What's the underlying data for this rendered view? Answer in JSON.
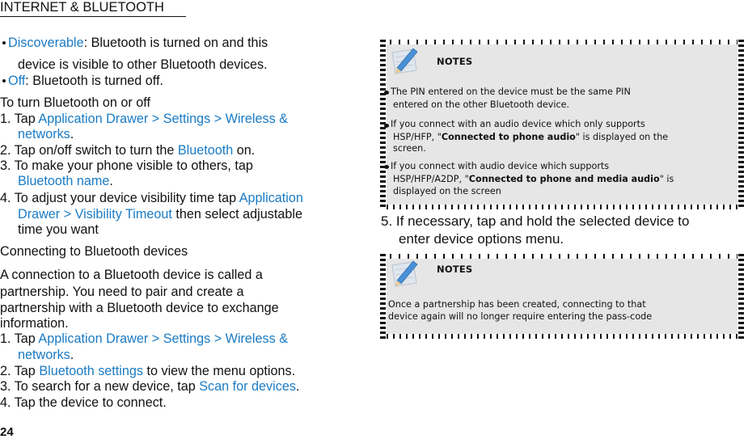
{
  "header": {
    "title": "INTERNET & BLUETOOTH"
  },
  "modes": [
    {
      "term": "Discoverable",
      "rest_line1": ": Bluetooth is turned on and this",
      "rest_line2": "device is visible to other Bluetooth devices."
    },
    {
      "term": "Off",
      "rest_line1": ": Bluetooth is turned off."
    }
  ],
  "turn_on_off": {
    "heading": "To turn Bluetooth on or off",
    "steps": [
      {
        "num": "1. Tap ",
        "link1": "Application Drawer > Settings > Wireless &",
        "link2": "networks",
        "tail": "."
      },
      {
        "num": "2. Tap on/off switch to turn the ",
        "link": "Bluetooth",
        "tail": " on."
      },
      {
        "num": "3. To make your phone visible to others, tap",
        "link": "Bluetooth name",
        "tail": "."
      },
      {
        "num": "4. To adjust your device visibility time tap ",
        "link1": "Application",
        "link2": "Drawer > Visibility Timeout",
        "tail2": " then select adjustable",
        "line3": "time you want"
      }
    ]
  },
  "connecting": {
    "heading": "Connecting to Bluetooth devices",
    "para_lines": [
      "A connection to a Bluetooth device is called a",
      "partnership. You need to pair and create a",
      "partnership with a Bluetooth device to exchange",
      "information."
    ],
    "steps": [
      {
        "num": "1. Tap ",
        "link1": "Application Drawer > Settings > Wireless &",
        "link2": "networks",
        "tail": "."
      },
      {
        "num": "2. Tap ",
        "link": "Bluetooth settings",
        "tail": " to view the menu options."
      },
      {
        "num": "3. To search for a new device, tap ",
        "link": "Scan for devices",
        "tail": "."
      },
      {
        "num": "4. Tap the device to connect."
      }
    ],
    "step5": {
      "line1": "5. If necessary, tap and hold the selected device to",
      "line2": "enter device options menu."
    }
  },
  "notes1": {
    "title": "NOTES",
    "icon": "notepad-pencil-icon",
    "items": [
      {
        "l1": "The PIN entered on the device must be the same PIN",
        "l2": "entered on the other Bluetooth device."
      },
      {
        "l1": "If you connect with an audio device which only supports",
        "l2_pre": "HSP/HFP, \"",
        "l2_bold": "Connected to phone audio",
        "l2_post": "\" is displayed on the",
        "l3": "screen."
      },
      {
        "l1": "If you connect with audio device which supports",
        "l2_pre": "HSP/HFP/A2DP, \"",
        "l2_bold": "Connected to phone and media audio",
        "l2_post": "\" is",
        "l3": "displayed on the screen"
      }
    ]
  },
  "notes2": {
    "title": "NOTES",
    "icon": "notepad-pencil-icon",
    "lines": [
      "Once a partnership has been created, connecting to that",
      "device again will no longer require entering the pass-code"
    ]
  },
  "page_number": "24",
  "colors": {
    "link": "#1a7bc4",
    "notes_bg": "#e6e6e6",
    "text": "#111111"
  }
}
